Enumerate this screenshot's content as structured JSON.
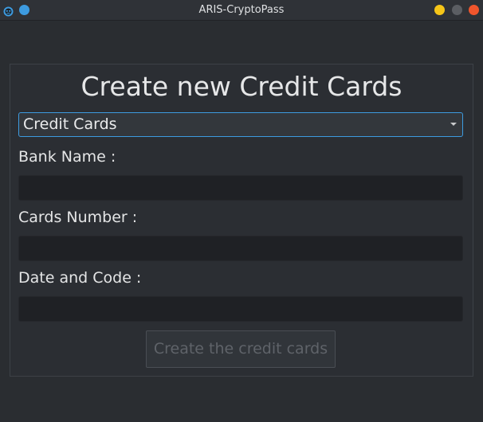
{
  "window": {
    "title": "ARIS-CryptoPass",
    "colors": {
      "accent": "#3d9be0",
      "minimize": "#f5c518",
      "maximize": "#5b5e63",
      "close": "#f0552c",
      "left_dot": "#3d9be0"
    }
  },
  "form": {
    "heading": "Create new Credit Cards",
    "category_select": {
      "selected": "Credit Cards"
    },
    "fields": [
      {
        "label": "Bank Name :",
        "value": ""
      },
      {
        "label": "Cards Number :",
        "value": ""
      },
      {
        "label": "Date and Code :",
        "value": ""
      }
    ],
    "submit_label": "Create the credit cards"
  }
}
